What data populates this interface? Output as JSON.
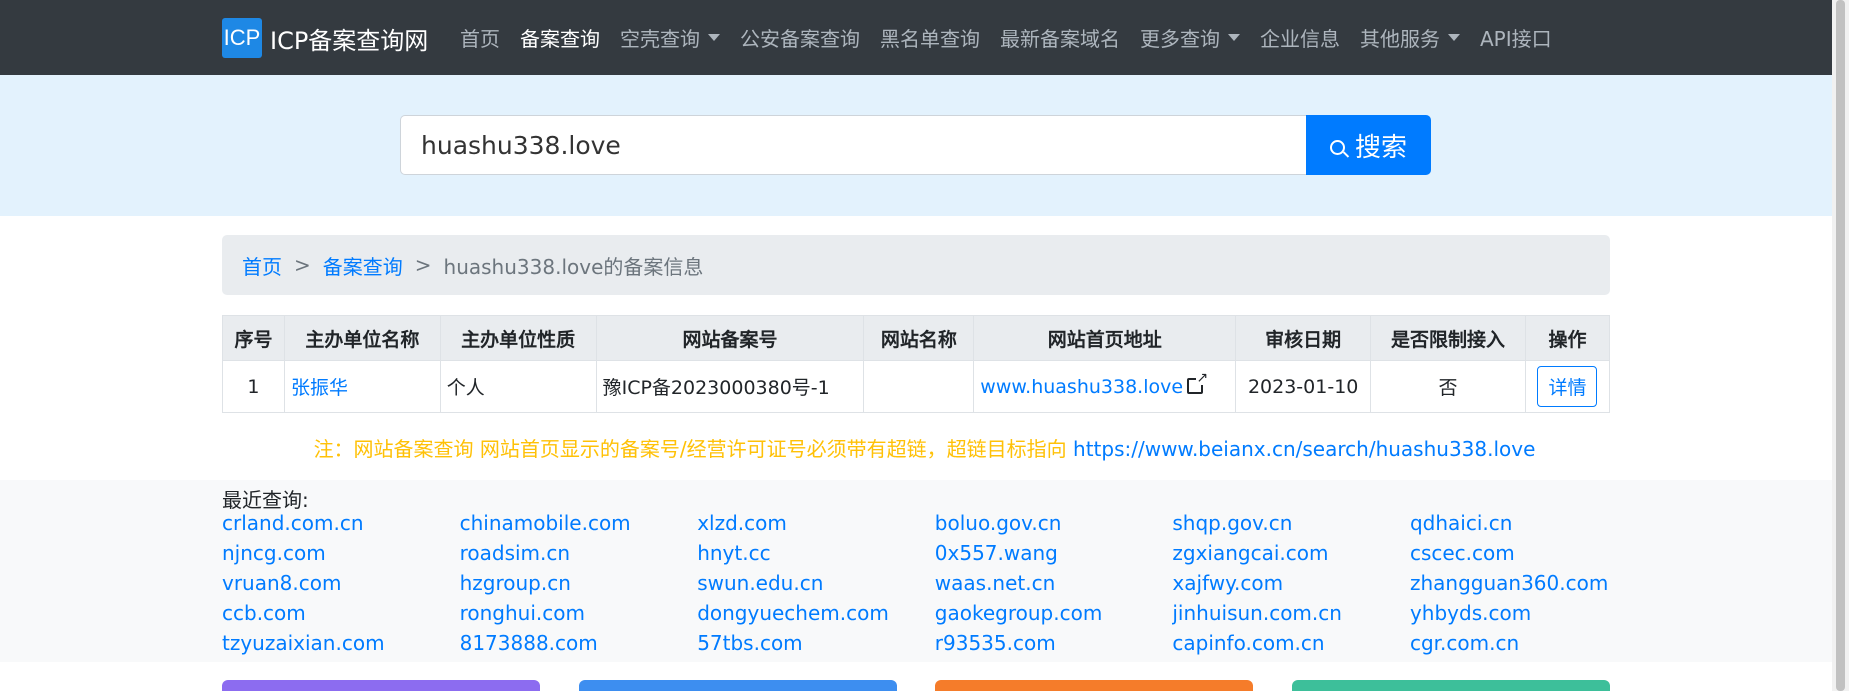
{
  "navbar": {
    "logo_text": "ICP",
    "brand": "ICP备案查询网",
    "items": [
      {
        "label": "首页",
        "active": false,
        "dropdown": false
      },
      {
        "label": "备案查询",
        "active": true,
        "dropdown": false
      },
      {
        "label": "空壳查询",
        "active": false,
        "dropdown": true
      },
      {
        "label": "公安备案查询",
        "active": false,
        "dropdown": false
      },
      {
        "label": "黑名单查询",
        "active": false,
        "dropdown": false
      },
      {
        "label": "最新备案域名",
        "active": false,
        "dropdown": false
      },
      {
        "label": "更多查询",
        "active": false,
        "dropdown": true
      },
      {
        "label": "企业信息",
        "active": false,
        "dropdown": false
      },
      {
        "label": "其他服务",
        "active": false,
        "dropdown": true
      },
      {
        "label": "API接口",
        "active": false,
        "dropdown": false
      }
    ]
  },
  "search": {
    "value": "huashu338.love",
    "button_label": "搜索"
  },
  "breadcrumb": {
    "home": "首页",
    "section": "备案查询",
    "sep": ">",
    "current": "huashu338.love的备案信息"
  },
  "table": {
    "headers": [
      "序号",
      "主办单位名称",
      "主办单位性质",
      "网站备案号",
      "网站名称",
      "网站首页地址",
      "审核日期",
      "是否限制接入",
      "操作"
    ],
    "rows": [
      {
        "index": "1",
        "org_name": "张振华",
        "org_type": "个人",
        "icp_no": "豫ICP备2023000380号-1",
        "site_name": "",
        "site_url": "www.huashu338.love",
        "date": "2023-01-10",
        "restricted": "否",
        "action": "详情"
      }
    ]
  },
  "note": {
    "text": "注：网站备案查询 网站首页显示的备案号/经营许可证号必须带有超链，超链目标指向 ",
    "link": "https://www.beianx.cn/search/huashu338.love"
  },
  "recent": {
    "title": "最近查询:",
    "links": [
      "crland.com.cn",
      "chinamobile.com",
      "xlzd.com",
      "boluo.gov.cn",
      "shqp.gov.cn",
      "qdhaici.cn",
      "njncg.com",
      "roadsim.cn",
      "hnyt.cc",
      "0x557.wang",
      "zgxiangcai.com",
      "cscec.com",
      "vruan8.com",
      "hzgroup.cn",
      "swun.edu.cn",
      "waas.net.cn",
      "xajfwy.com",
      "zhangguan360.com",
      "ccb.com",
      "ronghui.com",
      "dongyuechem.com",
      "gaokegroup.com",
      "jinhuisun.com.cn",
      "yhbyds.com",
      "tzyuzaixian.com",
      "8173888.com",
      "57tbs.com",
      "r93535.com",
      "capinfo.com.cn",
      "cgr.com.cn"
    ]
  },
  "colors": {
    "navbar": "#343a40",
    "search_band": "#e3f2fd",
    "accent": "#007bff",
    "note": "#ffc107",
    "card_colors": [
      "#8c6cf0",
      "#3d8ef0",
      "#f57c2a",
      "#3dbf9a"
    ]
  }
}
